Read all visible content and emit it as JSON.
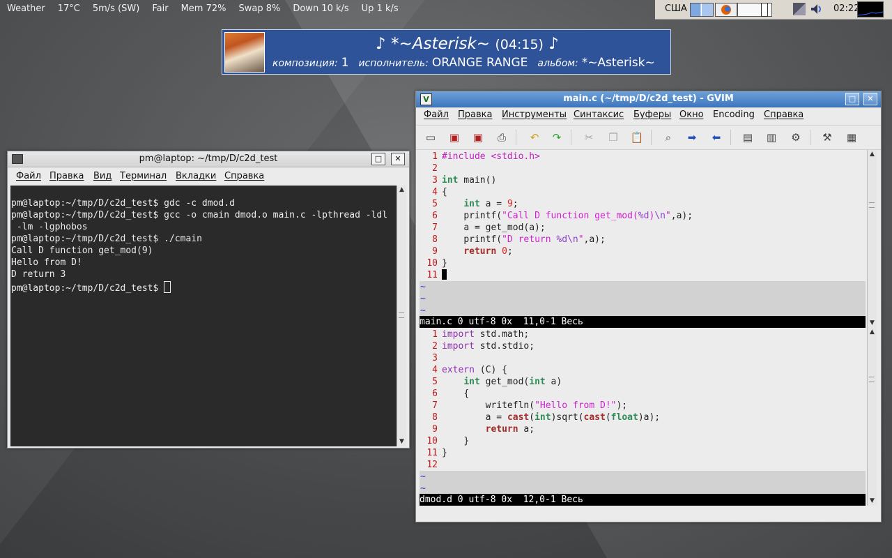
{
  "topbar": {
    "weather": "Weather",
    "temp": "17°C",
    "wind": "5m/s (SW)",
    "condition": "Fair",
    "mem": "Mem 72%",
    "swap": "Swap 8%",
    "down": "Down 10 k/s",
    "up": "Up 1 k/s"
  },
  "tray": {
    "layout": "США",
    "clock": "02:22"
  },
  "osd": {
    "title": "♪ *~Asterisk~",
    "duration": "(04:15)",
    "note": "♪",
    "track_label": "композиция:",
    "track": "1",
    "artist_label": "исполнитель:",
    "artist": "ORANGE RANGE",
    "album_label": "альбом:",
    "album": "*~Asterisk~"
  },
  "terminal": {
    "title": "pm@laptop: ~/tmp/D/c2d_test",
    "menu": [
      "Файл",
      "Правка",
      "Вид",
      "Терминал",
      "Вкладки",
      "Справка"
    ],
    "lines": [
      "pm@laptop:~/tmp/D/c2d_test$ gdc -c dmod.d",
      "pm@laptop:~/tmp/D/c2d_test$ gcc -o cmain dmod.o main.c -lpthread -ldl",
      " -lm -lgphobos",
      "pm@laptop:~/tmp/D/c2d_test$ ./cmain",
      "Call D function get_mod(9)",
      "Hello from D!",
      "D return 3",
      "pm@laptop:~/tmp/D/c2d_test$ "
    ]
  },
  "gvim": {
    "title": "main.c (~/tmp/D/c2d_test) - GVIM",
    "menu": [
      "Файл",
      "Правка",
      "Инструменты",
      "Синтаксис",
      "Буферы",
      "Окно",
      "Encoding",
      "Справка"
    ],
    "top_status": "main.c 0 utf-8 0x  11,0-1 Весь",
    "bottom_status": "dmod.d 0 utf-8 0x  12,0-1 Весь",
    "tilde": "~",
    "line_numbers_top": [
      "1",
      "2",
      "3",
      "4",
      "5",
      "6",
      "7",
      "8",
      "9",
      "10",
      "11"
    ],
    "line_numbers_bottom": [
      "1",
      "2",
      "3",
      "4",
      "5",
      "6",
      "7",
      "8",
      "9",
      "10",
      "11",
      "12"
    ],
    "c_code": {
      "l1": "#include <stdio.h>",
      "l3_kw": "int",
      "l3_rest": " main()",
      "l4": "{",
      "l5_kw": "int",
      "l5_a": " a = ",
      "l5_num": "9",
      "l5_end": ";",
      "l6_a": "printf(",
      "l6_str": "\"Call D function get_mod(",
      "l6_esc": "%d",
      "l6_esc2": "\\n",
      "l6_q": "\"",
      "l6_end": ",a);",
      "l7": "a = get_mod(a);",
      "l8_a": "printf(",
      "l8_str": "\"D return ",
      "l8_esc": "%d",
      "l8_esc2": "\\n",
      "l8_q": "\"",
      "l8_end": ",a);",
      "l9_kw": "return",
      "l9_num": "0",
      "l9_end": ";",
      "l10": "}"
    },
    "d_code": {
      "l1_kw": "import",
      "l1_rest": " std.math;",
      "l2_kw": "import",
      "l2_rest": " std.stdio;",
      "l4_kw": "extern",
      "l4_rest": " (C) {",
      "l5_kw": "int",
      "l5_a": " get_mod(",
      "l5_kw2": "int",
      "l5_b": " a)",
      "l6": "{",
      "l7_a": "writefln(",
      "l7_str": "\"Hello from D!\"",
      "l7_end": ");",
      "l8_a": "a = ",
      "l8_cast": "cast",
      "l8_p1": "(",
      "l8_int": "int",
      "l8_b": ")sqrt(",
      "l8_cast2": "cast",
      "l8_p2": "(",
      "l8_float": "float",
      "l8_c": ")a);",
      "l9_kw": "return",
      "l9_rest": " a;",
      "l10": "}",
      "l11": "}"
    }
  }
}
